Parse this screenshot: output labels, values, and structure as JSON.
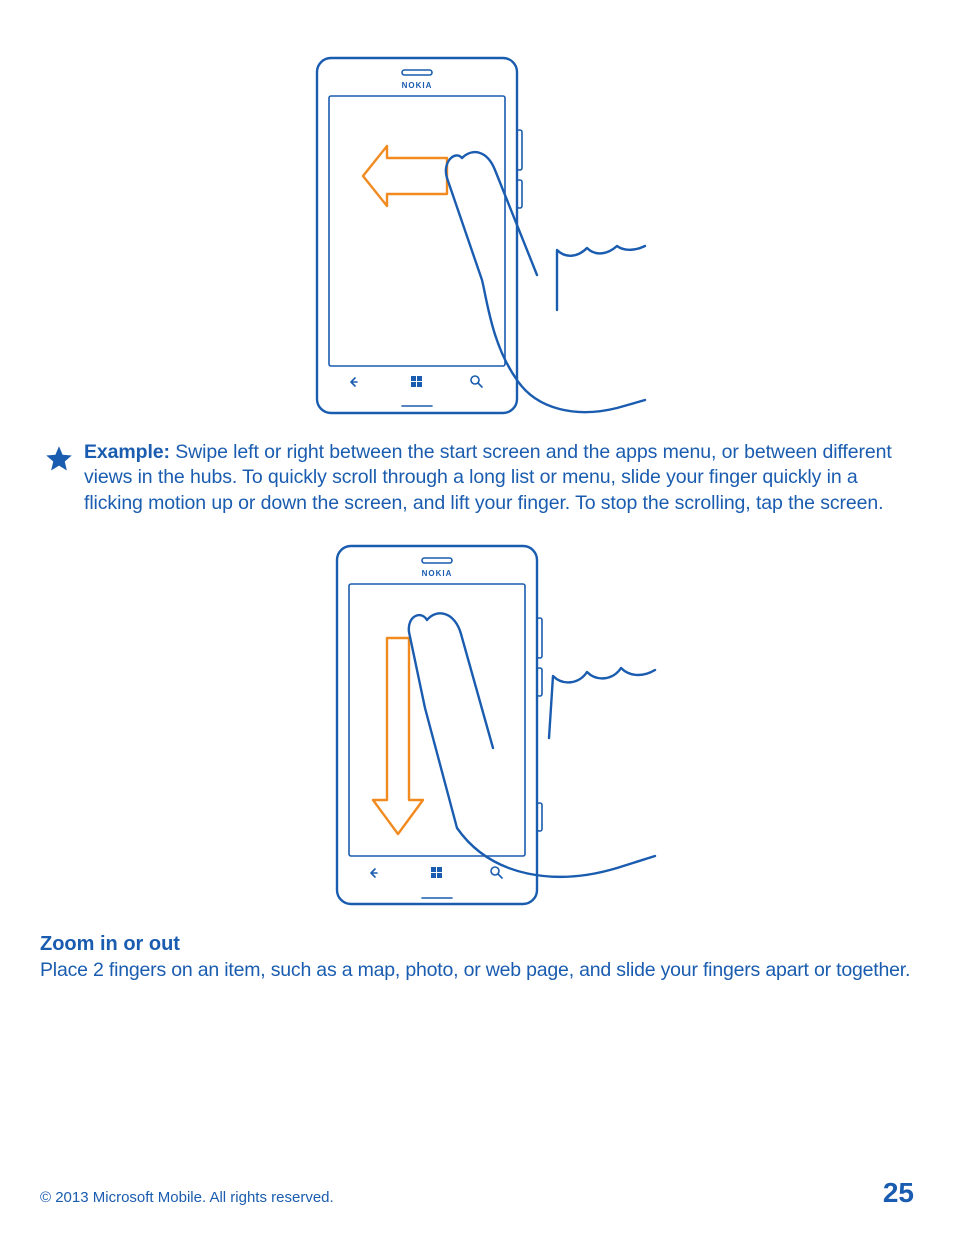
{
  "brand": "NOKIA",
  "example": {
    "label": "Example:",
    "text": "Swipe left or right between the start screen and the apps menu, or between different views in the hubs. To quickly scroll through a long list or menu, slide your finger quickly in a flicking motion up or down the screen, and lift your finger. To stop the scrolling, tap the screen."
  },
  "zoom": {
    "heading": "Zoom in or out",
    "text": "Place 2 fingers on an item, such as a map, photo, or web page, and slide your fingers apart or together."
  },
  "footer": {
    "copyright": "© 2013 Microsoft Mobile. All rights reserved.",
    "page": "25"
  }
}
